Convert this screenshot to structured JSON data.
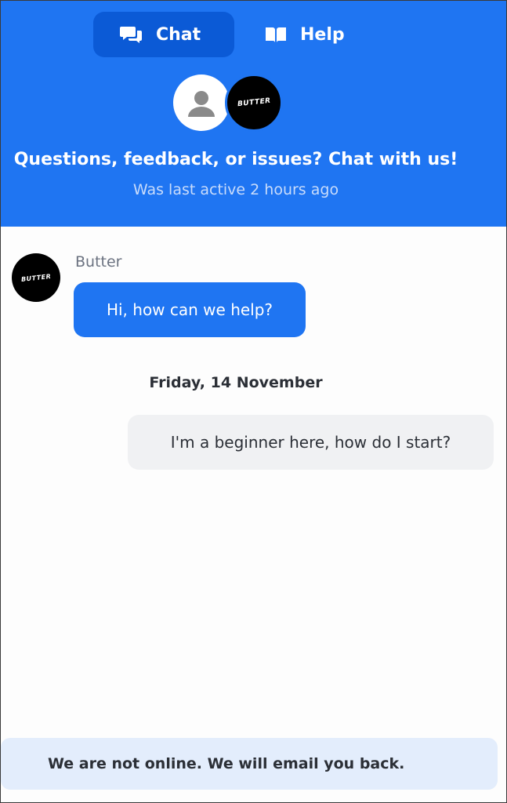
{
  "tabs": [
    {
      "label": "Chat",
      "icon": "chat-bubbles-icon",
      "active": true
    },
    {
      "label": "Help",
      "icon": "book-icon",
      "active": false
    }
  ],
  "header": {
    "headline": "Questions, feedback, or issues? Chat with us!",
    "status": "Was last active 2 hours ago",
    "brand_logo_text": "BUTTER"
  },
  "messages": [
    {
      "sender": "Butter",
      "text": "Hi, how can we help?",
      "direction": "incoming"
    },
    {
      "date_separator": "Friday, 14 November"
    },
    {
      "text": "I'm a beginner here, how do I start?",
      "direction": "outgoing"
    }
  ],
  "footer": {
    "notice": "We are not online. We will email you back."
  },
  "colors": {
    "accent": "#1f75f2",
    "accent_dark": "#0b5ad6",
    "outgoing_bubble": "#f0f1f3",
    "notice_bg": "#e3edfc"
  }
}
